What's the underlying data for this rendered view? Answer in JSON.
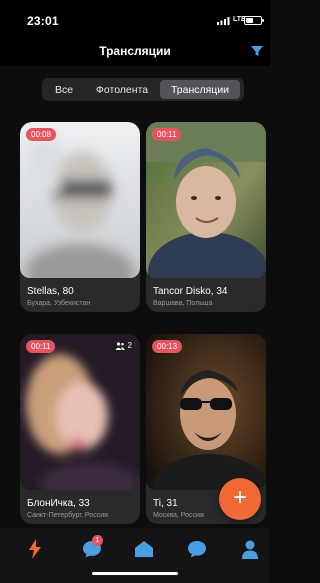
{
  "status": {
    "time": "23:01",
    "network": "LTE",
    "battery_level": 0.5
  },
  "header": {
    "title": "Трансляции",
    "filter_icon": "filter-icon"
  },
  "tabs": [
    {
      "label": "Все",
      "selected": false
    },
    {
      "label": "Фотолента",
      "selected": false
    },
    {
      "label": "Трансляции",
      "selected": true
    }
  ],
  "streams": [
    {
      "timer": "00:08",
      "viewers": "",
      "name": "Stellas, 80",
      "location": "Бухара, Узбекистан"
    },
    {
      "timer": "00:11",
      "viewers": "",
      "name": "Tancor Disko, 34",
      "location": "Варшава, Польша"
    },
    {
      "timer": "00:11",
      "viewers": "2",
      "name": "БлонИчка, 33",
      "location": "Санкт-Петербург, Россия"
    },
    {
      "timer": "00:13",
      "viewers": "",
      "name": "Ti, 31",
      "location": "Москва, Россия"
    }
  ],
  "fab": {
    "label": "+"
  },
  "bottom_nav": [
    {
      "icon": "lightning-icon",
      "active": true
    },
    {
      "icon": "chat-icon",
      "badge": "1"
    },
    {
      "icon": "home-icon"
    },
    {
      "icon": "messages-icon"
    },
    {
      "icon": "profile-icon"
    }
  ],
  "colors": {
    "accent": "#ef6a35",
    "timer_badge": "#e8545d",
    "nav_active": "#ef6a35",
    "nav_inactive": "#4a9fe0"
  }
}
